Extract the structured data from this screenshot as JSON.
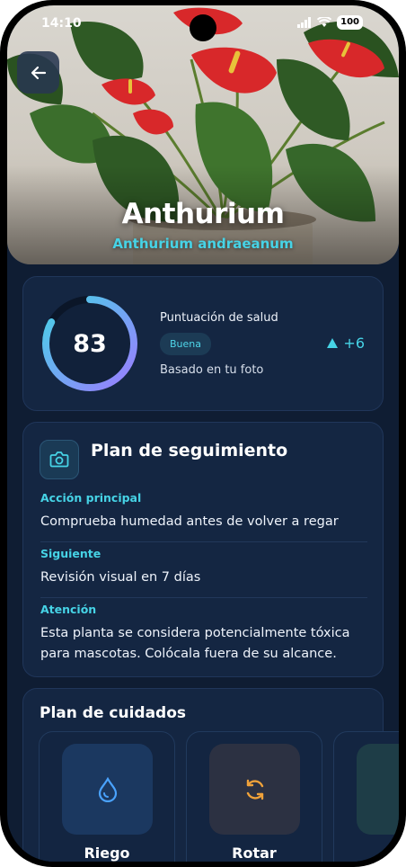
{
  "status": {
    "time": "14:10",
    "battery": "100"
  },
  "plant": {
    "name": "Anthurium",
    "scientific_name": "Anthurium andraeanum"
  },
  "health": {
    "score": "83",
    "score_fraction": 0.83,
    "label": "Puntuación de salud",
    "badge": "Buena",
    "note": "Basado en tu foto",
    "delta": "+6"
  },
  "follow_up": {
    "title": "Plan de seguimiento",
    "items": [
      {
        "label": "Acción principal",
        "text": "Comprueba humedad antes de volver a regar"
      },
      {
        "label": "Siguiente",
        "text": "Revisión visual en 7 días"
      },
      {
        "label": "Atención",
        "text": "Esta planta se considera potencialmente tóxica para mascotas. Colócala fuera de su alcance."
      }
    ]
  },
  "care_plan": {
    "title": "Plan de cuidados",
    "tiles": [
      {
        "label": "Riego",
        "icon": "water-drop-icon",
        "color": "#4aa3ff"
      },
      {
        "label": "Rotar",
        "icon": "rotate-icon",
        "color": "#f0a23a"
      }
    ]
  },
  "colors": {
    "accent": "#46d3e6",
    "background": "#0f1d33",
    "card": "#142642"
  }
}
